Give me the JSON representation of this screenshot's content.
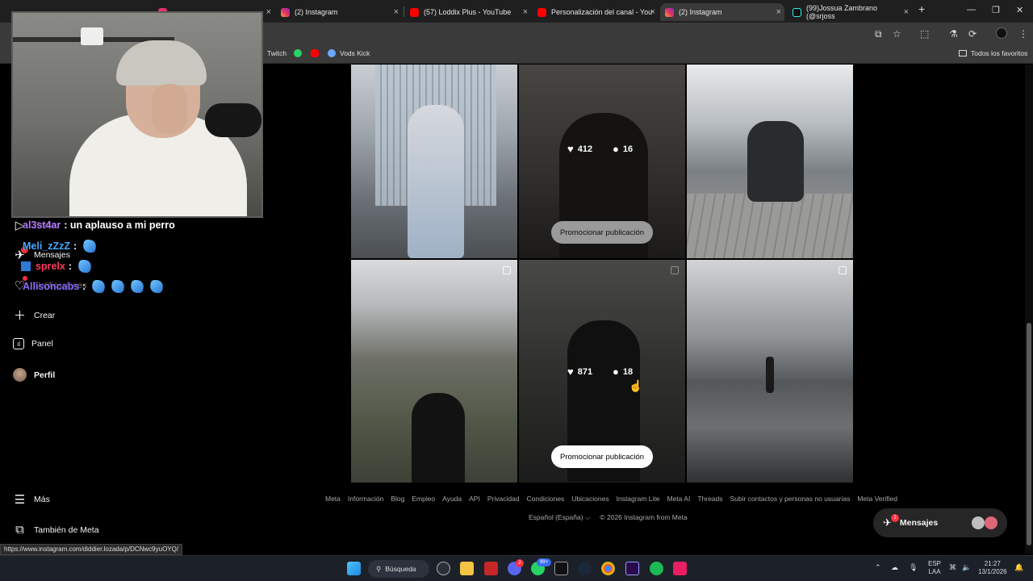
{
  "browser": {
    "tabs": [
      {
        "label": "",
        "favicon_color": "#e1306c",
        "close": "×"
      },
      {
        "label": "(2) Instagram",
        "favicon_color": "#e1306c",
        "close": "×"
      },
      {
        "label": "(57) Loddix Plus - YouTube",
        "favicon_color": "#ff0000",
        "close": "×"
      },
      {
        "label": "Personalización del canal - You",
        "favicon_color": "#ff0000",
        "close": "×"
      },
      {
        "label": "(2) Instagram",
        "favicon_color": "#e1306c",
        "close": "×"
      },
      {
        "label": "(99)Jossua Zambrano (@srjoss",
        "favicon_color": "#25f4ee",
        "close": "×"
      }
    ],
    "new_tab": "+",
    "window_controls": [
      "—",
      "❐",
      "✕"
    ],
    "bookmarks": [
      {
        "label": "Twitch",
        "icon": "twitch-icon"
      },
      {
        "label": "",
        "icon": "whatsapp-icon",
        "color": "#25d366"
      },
      {
        "label": "",
        "icon": "youtube-icon",
        "color": "#ff0000"
      },
      {
        "label": "Vods Kick",
        "icon": "kick-icon",
        "color": "#53fc18"
      }
    ],
    "all_bookmarks": "Todos los favoritos"
  },
  "chat": [
    {
      "user": "al3st4ar",
      "user_color": "#b47cff",
      "message": ": un aplauso a mi perro",
      "emotes": 0
    },
    {
      "user": "Meli_zZzZ",
      "user_color": "#4aa8ff",
      "message": " :",
      "emotes": 1
    },
    {
      "user": "sprelx",
      "user_color": "#ff3b5c",
      "message": " :",
      "emotes": 1
    },
    {
      "user": "Allisoncabs",
      "user_color": "#8a6bff",
      "message": " :",
      "emotes": 4
    }
  ],
  "sidenav": {
    "items": [
      {
        "label": "Reels",
        "icon": "reels-icon"
      },
      {
        "label": "Mensajes",
        "icon": "messenger-icon",
        "badge": "2"
      },
      {
        "label": "Notificaciones",
        "icon": "heart-icon"
      },
      {
        "label": "Crear",
        "icon": "plus-icon"
      },
      {
        "label": "Panel",
        "icon": "dashboard-icon"
      },
      {
        "label": "Perfil",
        "icon": "avatar"
      }
    ],
    "more": "Más",
    "also_meta": "También de Meta"
  },
  "posts": [
    {
      "likes": "",
      "comments": "",
      "promo": ""
    },
    {
      "likes": "412",
      "comments": "16",
      "promo": "Promocionar publicación"
    },
    {
      "likes": "",
      "comments": "",
      "promo": ""
    },
    {
      "likes": "",
      "comments": "",
      "promo": ""
    },
    {
      "likes": "871",
      "comments": "18",
      "promo": "Promocionar publicación"
    },
    {
      "likes": "",
      "comments": "",
      "promo": ""
    }
  ],
  "footer": {
    "links": [
      "Meta",
      "Información",
      "Blog",
      "Empleo",
      "Ayuda",
      "API",
      "Privacidad",
      "Condiciones",
      "Ubicaciones",
      "Instagram Lite",
      "Meta AI",
      "Threads",
      "Subir contactos y personas no usuarias",
      "Meta Verified"
    ],
    "language": "Español (España) ⌵",
    "copyright": "© 2026 Instagram from Meta"
  },
  "messages_pill": {
    "label": "Mensajes",
    "badge": "2"
  },
  "status_url": "https://www.instagram.com/diddier.lozada/p/DCNwc9yuOYQ/",
  "taskbar": {
    "search": "Búsqueda",
    "lang_top": "ESP",
    "lang_bottom": "LAA",
    "time": "21:27",
    "date": "13/1/2026",
    "discord_badge": "2",
    "whatsapp_badge": "99+"
  }
}
